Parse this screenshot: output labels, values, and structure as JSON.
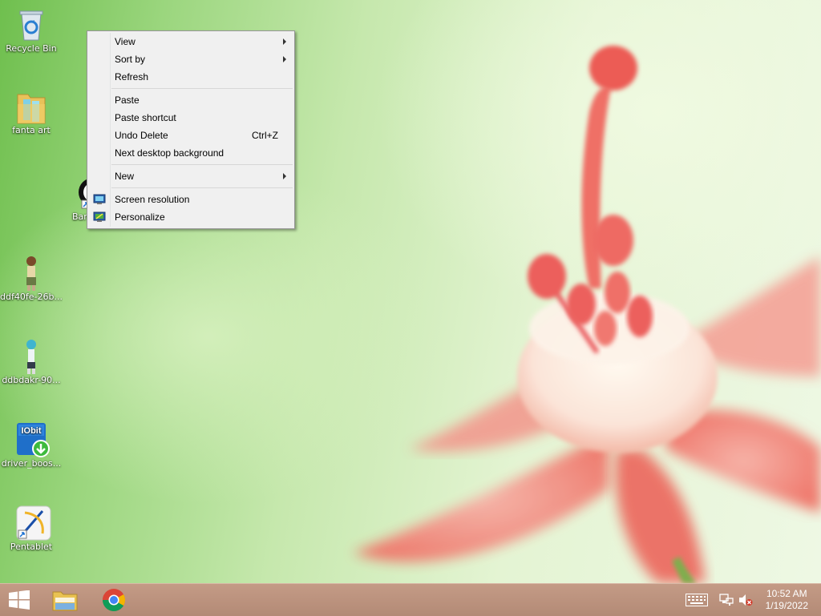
{
  "desktop": {
    "icons": [
      {
        "label": "Recycle Bin",
        "icon": "recycle-bin-icon"
      },
      {
        "label": "fanta art",
        "icon": "folder-icon"
      },
      {
        "label": "Bar",
        "icon": "shortcut-app-icon"
      },
      {
        "label": "ddf40fe-26b...",
        "icon": "image-file-icon"
      },
      {
        "label": "ddbdakr-90...",
        "icon": "image-file-icon"
      },
      {
        "label": "driver_boos...",
        "icon": "iobit-installer-icon"
      },
      {
        "label": "Pentablet",
        "icon": "pentablet-icon"
      }
    ],
    "iobit_badge": "IObit"
  },
  "context_menu": {
    "view": "View",
    "sort_by": "Sort by",
    "refresh": "Refresh",
    "paste": "Paste",
    "paste_shortcut": "Paste shortcut",
    "undo_delete": "Undo Delete",
    "undo_delete_shortcut": "Ctrl+Z",
    "next_background": "Next desktop background",
    "new": "New",
    "screen_resolution": "Screen resolution",
    "personalize": "Personalize"
  },
  "taskbar": {
    "pinned": [
      {
        "name": "start-button",
        "icon": "windows-logo-icon"
      },
      {
        "name": "file-explorer",
        "icon": "folder-icon"
      },
      {
        "name": "chrome",
        "icon": "chrome-icon"
      }
    ],
    "tray": {
      "time": "10:52 AM",
      "date": "1/19/2022",
      "icons": [
        "keyboard-icon",
        "network-icon",
        "volume-muted-icon"
      ]
    }
  },
  "colors": {
    "taskbar": "#b89078",
    "menu_bg": "#f0f0f0",
    "wallpaper_green": "#9bd67e",
    "flower_pink": "#f07a72"
  }
}
